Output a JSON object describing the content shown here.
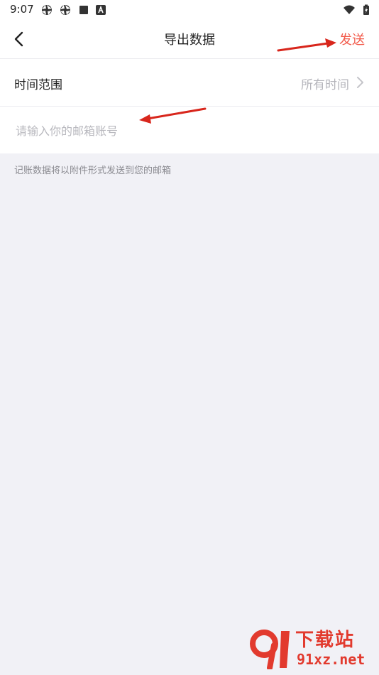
{
  "status_bar": {
    "time": "9:07",
    "icons": [
      "aperture-icon",
      "aperture-icon",
      "square-notification-icon",
      "a-notification-icon",
      "wifi-icon",
      "battery-icon"
    ]
  },
  "header": {
    "back_icon": "chevron-left-icon",
    "title": "导出数据",
    "send_label": "发送",
    "accent_color": "#f25a4a"
  },
  "time_range": {
    "label": "时间范围",
    "value": "所有时间",
    "icon": "chevron-right-icon"
  },
  "email": {
    "placeholder": "请输入你的邮箱账号",
    "value": ""
  },
  "hint": "记账数据将以附件形式发送到您的邮箱",
  "watermark": {
    "text_cn": "下载站",
    "text_en": "91xz.net"
  }
}
